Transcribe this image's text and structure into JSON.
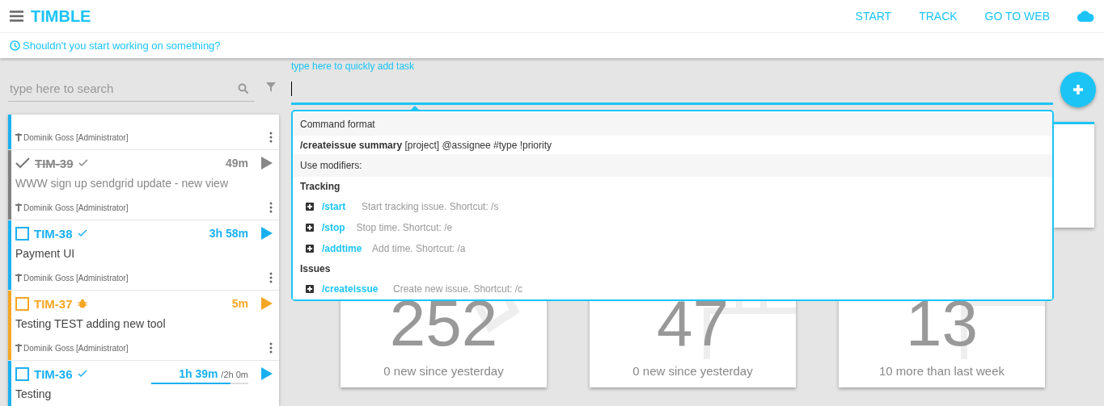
{
  "header": {
    "title": "TIMBLE",
    "nav": [
      "START",
      "TRACK",
      "GO TO WEB"
    ]
  },
  "notice": "Shouldn't you start working on something?",
  "search": {
    "placeholder": "type here to search"
  },
  "tasks": [
    {
      "kind": "partial",
      "author": "Dominik Goss [Administrator]",
      "color": "#1ab0f0"
    },
    {
      "kind": "done",
      "id": "TIM-39",
      "bug": false,
      "time": "49m",
      "title": "WWW sign up sendgrid update - new view",
      "author": "Dominik Goss [Administrator]",
      "color": "#808080"
    },
    {
      "kind": "open",
      "id": "TIM-38",
      "bug": false,
      "time": "3h 58m",
      "title": "Payment UI",
      "author": "Dominik Goss [Administrator]",
      "color": "#1ab0f0"
    },
    {
      "kind": "open",
      "id": "TIM-37",
      "bug": true,
      "time": "5m",
      "title": "Testing TEST adding new tool",
      "author": "Dominik Goss [Administrator]",
      "color": "#f5a623"
    },
    {
      "kind": "open",
      "id": "TIM-36",
      "bug": false,
      "time": "1h 39m",
      "estimate": "/2h 0m",
      "level": 0.82,
      "title": "Testing",
      "color": "#1ab0f0"
    }
  ],
  "quick_add": {
    "label": "type here to quickly add task"
  },
  "commands": [
    {
      "kind": "header",
      "text": "Command format"
    },
    {
      "kind": "format",
      "text": "**/createissue summary** [project] @assignee #type !priority"
    },
    {
      "kind": "header",
      "text": "Use modifiers:"
    },
    {
      "kind": "section",
      "text": "Tracking"
    },
    {
      "kind": "command",
      "command": "/start",
      "text": "Start tracking issue. Shortcut: /s"
    },
    {
      "kind": "command",
      "command": "/stop",
      "text": "Stop time. Shortcut: /e"
    },
    {
      "kind": "command",
      "command": "/addtime",
      "text": "Add time. Shortcut: /a"
    },
    {
      "kind": "section",
      "text": "Issues"
    },
    {
      "kind": "command",
      "command": "/createissue",
      "text": "Create new issue. Shortcut: /c"
    }
  ],
  "stats": [
    {
      "value": "252",
      "caption": "0 new since yesterday"
    },
    {
      "value": "47",
      "caption": "0 new since yesterday"
    },
    {
      "value": "13",
      "caption": "10 more than last week"
    }
  ]
}
